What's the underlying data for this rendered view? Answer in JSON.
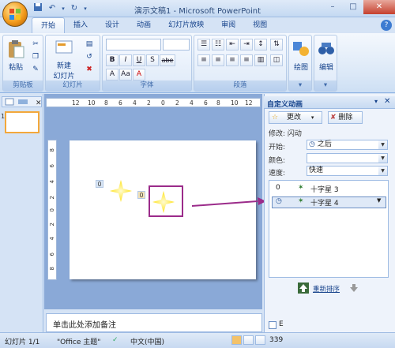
{
  "window": {
    "title": "演示文稿1 - Microsoft PowerPoint"
  },
  "qat": {
    "undo_icon": "undo-icon",
    "redo_icon": "redo-icon"
  },
  "tabs": [
    "开始",
    "插入",
    "设计",
    "动画",
    "幻灯片放映",
    "审阅",
    "视图"
  ],
  "ribbon": {
    "clipboard": {
      "label": "剪贴板",
      "paste": "粘贴"
    },
    "slides": {
      "label": "幻灯片",
      "new_slide_1": "新建",
      "new_slide_2": "幻灯片"
    },
    "font": {
      "label": "字体",
      "bold": "B",
      "italic": "I",
      "underline": "U",
      "strike": "S",
      "shadow": "abe",
      "sizing": "A"
    },
    "paragraph": {
      "label": "段落"
    },
    "drawing": {
      "label": "绘图"
    },
    "editing": {
      "label": "编辑"
    }
  },
  "ruler": {
    "h_ticks": [
      "12",
      "10",
      "8",
      "6",
      "4",
      "2",
      "0",
      "2",
      "4",
      "6",
      "8",
      "10",
      "12"
    ],
    "v_ticks": [
      "8",
      "6",
      "4",
      "2",
      "0",
      "2",
      "4",
      "6",
      "8"
    ]
  },
  "slide": {
    "tag_star1": "0",
    "tag_star2": "0"
  },
  "notes": {
    "placeholder": "单击此处添加备注"
  },
  "anim_pane": {
    "title": "自定义动画",
    "change_btn": "更改",
    "delete_btn": "删除",
    "modify_label": "修改: 闪动",
    "start_label": "开始:",
    "start_value": "之后",
    "color_label": "颜色:",
    "color_value": "",
    "speed_label": "速度:",
    "speed_value": "快速",
    "items": [
      {
        "num": "0",
        "name": "十字星 3"
      },
      {
        "num": "",
        "name": "十字星 4"
      }
    ],
    "reorder": "重新排序",
    "autopreview": "E"
  },
  "status": {
    "slide_info": "幻灯片 1/1",
    "theme": "\"Office 主题\"",
    "language": "中文(中国)",
    "zoom": "339"
  },
  "colors": {
    "accent": "#9b2b8a",
    "star": "#ffee33"
  }
}
